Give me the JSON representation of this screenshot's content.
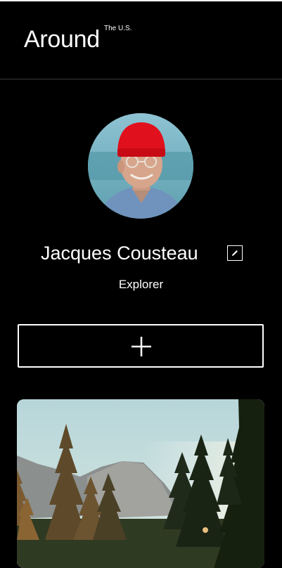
{
  "header": {
    "logo_text": "Around",
    "logo_superscript": "The U.S."
  },
  "profile": {
    "name": "Jacques Cousteau",
    "role": "Explorer",
    "avatar_icon": "profile-photo",
    "edit_icon": "pencil-icon"
  },
  "actions": {
    "add_icon": "plus-icon"
  },
  "colors": {
    "background": "#000000",
    "text": "#ffffff",
    "divider": "#3a3a3a"
  },
  "cards": [
    {
      "image": "forest-valley-photo"
    }
  ]
}
